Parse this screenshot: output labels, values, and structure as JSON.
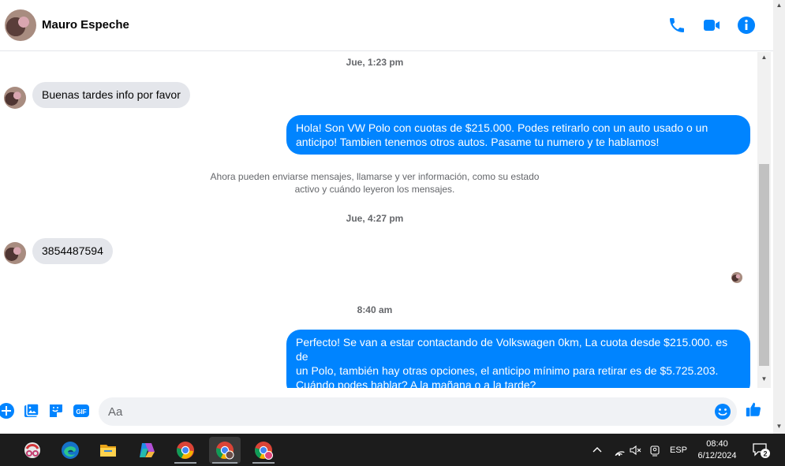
{
  "header": {
    "contact_name": "Mauro Espeche",
    "icons": [
      "phone-icon",
      "video-call-icon",
      "info-icon"
    ],
    "accent": "#0084ff"
  },
  "chat": {
    "timestamps": [
      "Jue, 1:23 pm",
      "Jue, 4:27 pm",
      "8:40 am"
    ],
    "system_message": {
      "line1": "Ahora pueden enviarse mensajes, llamarse y ver información, como su estado",
      "line2": "activo y cuándo leyeron los mensajes."
    },
    "messages": [
      {
        "from": "contact",
        "text": "Buenas tardes info por favor"
      },
      {
        "from": "me",
        "lines": [
          "Hola! Son VW Polo con cuotas de $215.000. Podes retirarlo con un auto usado o un",
          "anticipo! Tambien tenemos otros autos. Pasame tu numero y te hablamos!"
        ]
      },
      {
        "from": "contact",
        "text": "3854487594"
      },
      {
        "from": "me",
        "lines": [
          "Perfecto!  Se van a estar contactando de Volkswagen 0km, La cuota desde $215.000. es de",
          "un Polo, también hay otras opciones, el anticipo mínimo para retirar es de $5.725.203.",
          "Cuándo podes hablar? A la mañana o a la tarde?"
        ]
      }
    ]
  },
  "composer": {
    "placeholder": "Aa",
    "icons": [
      "plus-icon",
      "image-icon",
      "sticker-icon",
      "gif-icon",
      "emoji-icon",
      "like-icon"
    ],
    "gif_label": "GIF"
  },
  "taskbar": {
    "apps": [
      "snipping-tool-icon",
      "edge-icon",
      "file-explorer-icon",
      "copilot-icon",
      "chrome-icon",
      "chrome-profile-icon",
      "chrome-profile-c-icon"
    ],
    "language": "ESP",
    "time": "08:40",
    "date": "6/12/2024",
    "notification_count": "2"
  }
}
